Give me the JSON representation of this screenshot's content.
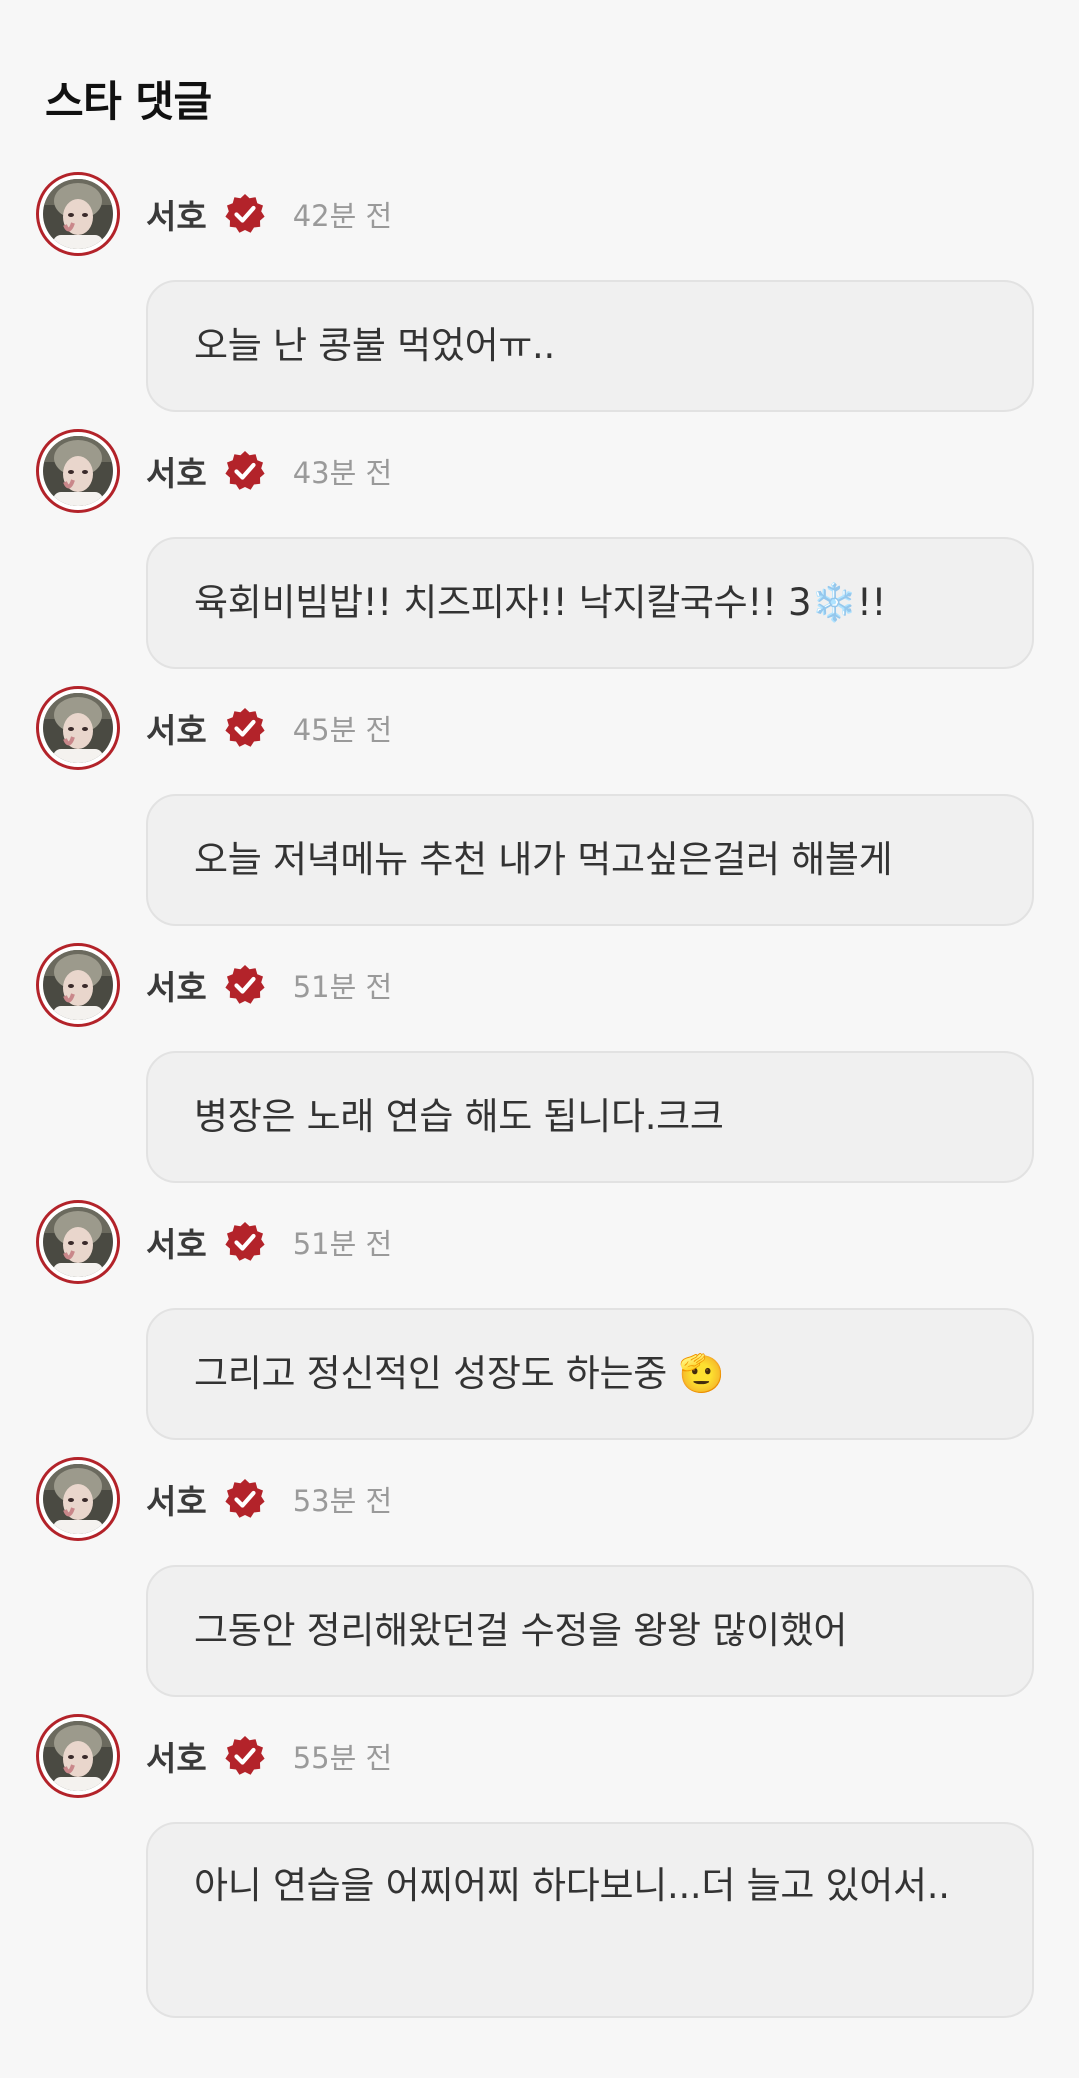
{
  "section": {
    "title": "스타 댓글"
  },
  "colors": {
    "verified": "#b3232a",
    "avatar_ring": "#b3232a",
    "bubble_bg": "#f0f0f0",
    "time": "#9a9a9a"
  },
  "comments": [
    {
      "author": "서호",
      "time": "42분 전",
      "text": "오늘 난 콩불 먹었어ㅠ.."
    },
    {
      "author": "서호",
      "time": "43분 전",
      "text": "육회비빔밥!! 치즈피자!! 낙지칼국수!! 3❄️!!"
    },
    {
      "author": "서호",
      "time": "45분 전",
      "text": "오늘 저녁메뉴 추천 내가 먹고싶은걸러 해볼게"
    },
    {
      "author": "서호",
      "time": "51분 전",
      "text": "병장은 노래 연습 해도 됩니다.크크"
    },
    {
      "author": "서호",
      "time": "51분 전",
      "text": "그리고 정신적인 성장도 하는중 🫡"
    },
    {
      "author": "서호",
      "time": "53분 전",
      "text": "그동안 정리해왔던걸 수정을 왕왕 많이했어"
    },
    {
      "author": "서호",
      "time": "55분 전",
      "text": "아니 연습을 어찌어찌 하다보니...더 늘고 있어서.."
    }
  ]
}
